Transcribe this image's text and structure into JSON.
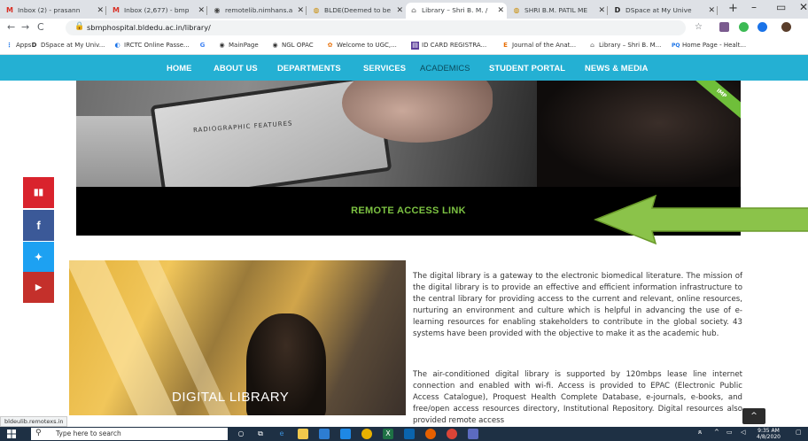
{
  "browser": {
    "tabs": [
      {
        "label": "Inbox (2) - prasann",
        "favicon": "gmail-icon",
        "color": "#d93025"
      },
      {
        "label": "Inbox (2,677) - bmp",
        "favicon": "gmail-icon",
        "color": "#d93025"
      },
      {
        "label": "remotelib.nimhans.a",
        "favicon": "globe-icon",
        "color": "#444444"
      },
      {
        "label": "BLDE(Deemed to be",
        "favicon": "blde-icon",
        "color": "#c98b00"
      },
      {
        "label": "Library – Shri B. M. /",
        "favicon": "library-icon",
        "color": "#888888",
        "active": true
      },
      {
        "label": "SHRI B.M. PATIL ME",
        "favicon": "blde-icon",
        "color": "#c98b00"
      },
      {
        "label": "DSpace at My Unive",
        "favicon": "dspace-icon",
        "color": "#222222"
      }
    ],
    "new_tab": "+",
    "close": "✕",
    "url": "sbmphospital.bldedu.ac.in/library/",
    "bookmarks": [
      {
        "label": "Apps"
      },
      {
        "label": "DSpace at My Univ..."
      },
      {
        "label": "IRCTC Online Passe..."
      },
      {
        "label": "MainPage"
      },
      {
        "label": "NGL OPAC"
      },
      {
        "label": "Welcome to UGC,..."
      },
      {
        "label": "ID CARD REGISTRA..."
      },
      {
        "label": "Journal of the Anat..."
      },
      {
        "label": "Library – Shri B. M..."
      },
      {
        "label": "Home Page - Healt..."
      }
    ],
    "status_url": "bldeulib.remotexs.in"
  },
  "site": {
    "nav": [
      "HOME",
      "ABOUT US",
      "DEPARTMENTS",
      "SERVICES",
      "ACADEMICS",
      "STUDENT PORTAL",
      "NEWS & MEDIA"
    ],
    "active_nav": "ACADEMICS",
    "hero": {
      "ribbon": "IMP",
      "tablet_text": "RADIOGRAPHIC FEATURES",
      "link_label": "REMOTE ACCESS LINK"
    },
    "social": [
      {
        "name": "map",
        "color": "#d9232d",
        "glyph": "▮▮"
      },
      {
        "name": "facebook",
        "color": "#3b5998",
        "glyph": "f"
      },
      {
        "name": "twitter",
        "color": "#1da1f2",
        "glyph": "✦"
      },
      {
        "name": "youtube",
        "color": "#c4302b",
        "glyph": "▶"
      }
    ],
    "digital_library_label": "DIGITAL LIBRARY",
    "paragraph1": "The digital library is a gateway to the electronic biomedical literature. The mission of the digital library is to provide an effective and efficient information infrastructure to the central library for providing access to the current and relevant, online resources, nurturing an environment and culture which is helpful in advancing the use of e-learning resources for enabling stakeholders to contribute in the global society. 43 systems have been provided with the objective to make it as the academic hub.",
    "paragraph2": "The air-conditioned digital library is supported by 120mbps lease line internet connection and enabled with wi-fi. Access is provided to EPAC (Electronic Public Access Catalogue), Proquest Health Complete Database, e-journals, e-books, and free/open access resources directory, Institutional Repository. Digital resources also provided remote access",
    "scroll_top": "^"
  },
  "taskbar": {
    "search_placeholder": "Type here to search",
    "time": "9:35 AM",
    "date": "4/8/2020"
  }
}
